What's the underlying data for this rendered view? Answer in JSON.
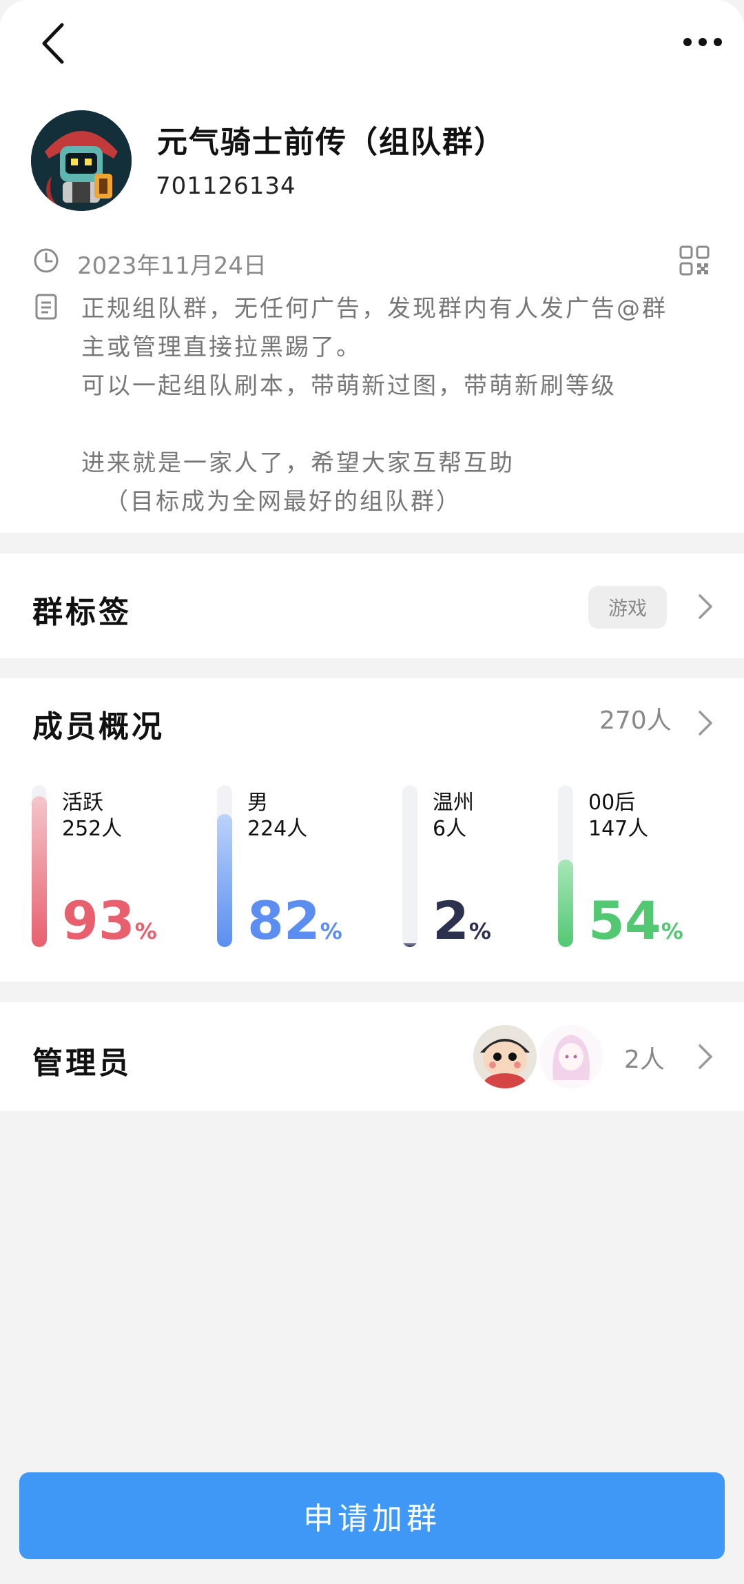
{
  "nav": {
    "back_icon": "chevron-left-icon",
    "more_icon": "more-horizontal-icon"
  },
  "group": {
    "name": "元气骑士前传（组队群）",
    "id": "701126134",
    "avatar_icon": "knight-robot-avatar"
  },
  "info": {
    "date": "2023年11月24日",
    "date_icon": "clock-icon",
    "qr_icon": "qr-code-icon",
    "desc_icon": "document-icon",
    "description_lines": [
      "正规组队群，无任何广告，发现群内有人发广告@群",
      "主或管理直接拉黑踢了。",
      "可以一起组队刷本，带萌新过图，带萌新刷等级",
      "",
      "进来就是一家人了，希望大家互帮互助",
      "（目标成为全网最好的组队群）"
    ]
  },
  "tags": {
    "title": "群标签",
    "tag": "游戏"
  },
  "members": {
    "title": "成员概况",
    "total": "270人",
    "stats": [
      {
        "label": "活跃",
        "count": "252人",
        "percent": 93,
        "color": "#e8606e",
        "track_color": "#f4c6cb"
      },
      {
        "label": "男",
        "count": "224人",
        "percent": 82,
        "color": "#5b8ef0",
        "track_color": "#bcd2fa"
      },
      {
        "label": "温州",
        "count": "6人",
        "percent": 2,
        "color": "#2c3150",
        "track_color": "#8f93a7"
      },
      {
        "label": "00后",
        "count": "147人",
        "percent": 54,
        "color": "#52c873",
        "track_color": "#a8e6b9"
      }
    ],
    "percent_sign": "%"
  },
  "admins": {
    "title": "管理员",
    "count": "2人"
  },
  "join_button": "申请加群",
  "colors": {
    "accent": "#3f97f6",
    "background": "#f3f3f3"
  }
}
